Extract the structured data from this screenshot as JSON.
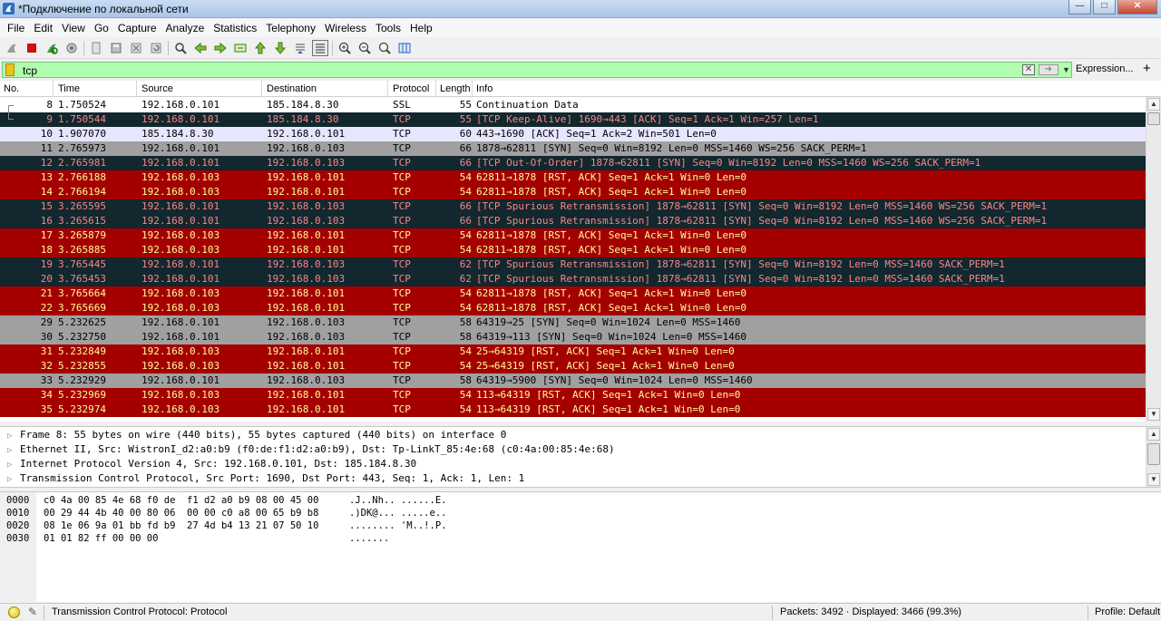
{
  "window": {
    "title": "*Подключение по локальной сети"
  },
  "menu": [
    "File",
    "Edit",
    "View",
    "Go",
    "Capture",
    "Analyze",
    "Statistics",
    "Telephony",
    "Wireless",
    "Tools",
    "Help"
  ],
  "filter": {
    "value": "tcp",
    "expression_label": "Expression...",
    "add_label": "+"
  },
  "columns": {
    "no": "No.",
    "time": "Time",
    "source": "Source",
    "destination": "Destination",
    "protocol": "Protocol",
    "length": "Length",
    "info": "Info"
  },
  "colors": {
    "red_bg": "#a40000",
    "red_fg": "#fffc9c",
    "dark_bg": "#12272e",
    "dark_fg": "#f78787",
    "gray_bg": "#a0a0a0",
    "selected_bg": "#e7e6ff",
    "white_bg": "#ffffff"
  },
  "packets": [
    {
      "no": "8",
      "time": "1.750524",
      "src": "192.168.0.101",
      "dst": "185.184.8.30",
      "proto": "SSL",
      "len": "55",
      "info": "Continuation Data",
      "style": "white"
    },
    {
      "no": "9",
      "time": "1.750544",
      "src": "192.168.0.101",
      "dst": "185.184.8.30",
      "proto": "TCP",
      "len": "55",
      "info": "[TCP Keep-Alive] 1690→443 [ACK] Seq=1 Ack=1 Win=257 Len=1",
      "style": "dark"
    },
    {
      "no": "10",
      "time": "1.907070",
      "src": "185.184.8.30",
      "dst": "192.168.0.101",
      "proto": "TCP",
      "len": "60",
      "info": "443→1690 [ACK] Seq=1 Ack=2 Win=501 Len=0",
      "style": "selected"
    },
    {
      "no": "11",
      "time": "2.765973",
      "src": "192.168.0.101",
      "dst": "192.168.0.103",
      "proto": "TCP",
      "len": "66",
      "info": "1878→62811 [SYN] Seq=0 Win=8192 Len=0 MSS=1460 WS=256 SACK_PERM=1",
      "style": "gray"
    },
    {
      "no": "12",
      "time": "2.765981",
      "src": "192.168.0.101",
      "dst": "192.168.0.103",
      "proto": "TCP",
      "len": "66",
      "info": "[TCP Out-Of-Order] 1878→62811 [SYN] Seq=0 Win=8192 Len=0 MSS=1460 WS=256 SACK_PERM=1",
      "style": "dark"
    },
    {
      "no": "13",
      "time": "2.766188",
      "src": "192.168.0.103",
      "dst": "192.168.0.101",
      "proto": "TCP",
      "len": "54",
      "info": "62811→1878 [RST, ACK] Seq=1 Ack=1 Win=0 Len=0",
      "style": "red"
    },
    {
      "no": "14",
      "time": "2.766194",
      "src": "192.168.0.103",
      "dst": "192.168.0.101",
      "proto": "TCP",
      "len": "54",
      "info": "62811→1878 [RST, ACK] Seq=1 Ack=1 Win=0 Len=0",
      "style": "red"
    },
    {
      "no": "15",
      "time": "3.265595",
      "src": "192.168.0.101",
      "dst": "192.168.0.103",
      "proto": "TCP",
      "len": "66",
      "info": "[TCP Spurious Retransmission] 1878→62811 [SYN] Seq=0 Win=8192 Len=0 MSS=1460 WS=256 SACK_PERM=1",
      "style": "dark"
    },
    {
      "no": "16",
      "time": "3.265615",
      "src": "192.168.0.101",
      "dst": "192.168.0.103",
      "proto": "TCP",
      "len": "66",
      "info": "[TCP Spurious Retransmission] 1878→62811 [SYN] Seq=0 Win=8192 Len=0 MSS=1460 WS=256 SACK_PERM=1",
      "style": "dark"
    },
    {
      "no": "17",
      "time": "3.265879",
      "src": "192.168.0.103",
      "dst": "192.168.0.101",
      "proto": "TCP",
      "len": "54",
      "info": "62811→1878 [RST, ACK] Seq=1 Ack=1 Win=0 Len=0",
      "style": "red"
    },
    {
      "no": "18",
      "time": "3.265885",
      "src": "192.168.0.103",
      "dst": "192.168.0.101",
      "proto": "TCP",
      "len": "54",
      "info": "62811→1878 [RST, ACK] Seq=1 Ack=1 Win=0 Len=0",
      "style": "red"
    },
    {
      "no": "19",
      "time": "3.765445",
      "src": "192.168.0.101",
      "dst": "192.168.0.103",
      "proto": "TCP",
      "len": "62",
      "info": "[TCP Spurious Retransmission] 1878→62811 [SYN] Seq=0 Win=8192 Len=0 MSS=1460 SACK_PERM=1",
      "style": "dark"
    },
    {
      "no": "20",
      "time": "3.765453",
      "src": "192.168.0.101",
      "dst": "192.168.0.103",
      "proto": "TCP",
      "len": "62",
      "info": "[TCP Spurious Retransmission] 1878→62811 [SYN] Seq=0 Win=8192 Len=0 MSS=1460 SACK_PERM=1",
      "style": "dark"
    },
    {
      "no": "21",
      "time": "3.765664",
      "src": "192.168.0.103",
      "dst": "192.168.0.101",
      "proto": "TCP",
      "len": "54",
      "info": "62811→1878 [RST, ACK] Seq=1 Ack=1 Win=0 Len=0",
      "style": "red"
    },
    {
      "no": "22",
      "time": "3.765669",
      "src": "192.168.0.103",
      "dst": "192.168.0.101",
      "proto": "TCP",
      "len": "54",
      "info": "62811→1878 [RST, ACK] Seq=1 Ack=1 Win=0 Len=0",
      "style": "red"
    },
    {
      "no": "29",
      "time": "5.232625",
      "src": "192.168.0.101",
      "dst": "192.168.0.103",
      "proto": "TCP",
      "len": "58",
      "info": "64319→25 [SYN] Seq=0 Win=1024 Len=0 MSS=1460",
      "style": "gray"
    },
    {
      "no": "30",
      "time": "5.232750",
      "src": "192.168.0.101",
      "dst": "192.168.0.103",
      "proto": "TCP",
      "len": "58",
      "info": "64319→113 [SYN] Seq=0 Win=1024 Len=0 MSS=1460",
      "style": "gray"
    },
    {
      "no": "31",
      "time": "5.232849",
      "src": "192.168.0.103",
      "dst": "192.168.0.101",
      "proto": "TCP",
      "len": "54",
      "info": "25→64319 [RST, ACK] Seq=1 Ack=1 Win=0 Len=0",
      "style": "red"
    },
    {
      "no": "32",
      "time": "5.232855",
      "src": "192.168.0.103",
      "dst": "192.168.0.101",
      "proto": "TCP",
      "len": "54",
      "info": "25→64319 [RST, ACK] Seq=1 Ack=1 Win=0 Len=0",
      "style": "red"
    },
    {
      "no": "33",
      "time": "5.232929",
      "src": "192.168.0.101",
      "dst": "192.168.0.103",
      "proto": "TCP",
      "len": "58",
      "info": "64319→5900 [SYN] Seq=0 Win=1024 Len=0 MSS=1460",
      "style": "gray"
    },
    {
      "no": "34",
      "time": "5.232969",
      "src": "192.168.0.103",
      "dst": "192.168.0.101",
      "proto": "TCP",
      "len": "54",
      "info": "113→64319 [RST, ACK] Seq=1 Ack=1 Win=0 Len=0",
      "style": "red"
    },
    {
      "no": "35",
      "time": "5.232974",
      "src": "192.168.0.103",
      "dst": "192.168.0.101",
      "proto": "TCP",
      "len": "54",
      "info": "113→64319 [RST, ACK] Seq=1 Ack=1 Win=0 Len=0",
      "style": "red"
    }
  ],
  "details": [
    "Frame 8: 55 bytes on wire (440 bits), 55 bytes captured (440 bits) on interface 0",
    "Ethernet II, Src: WistronI_d2:a0:b9 (f0:de:f1:d2:a0:b9), Dst: Tp-LinkT_85:4e:68 (c0:4a:00:85:4e:68)",
    "Internet Protocol Version 4, Src: 192.168.0.101, Dst: 185.184.8.30",
    "Transmission Control Protocol, Src Port: 1690, Dst Port: 443, Seq: 1, Ack: 1, Len: 1"
  ],
  "bytes": [
    {
      "offset": "0000",
      "hex": "c0 4a 00 85 4e 68 f0 de  f1 d2 a0 b9 08 00 45 00",
      "ascii": ".J..Nh.. ......E."
    },
    {
      "offset": "0010",
      "hex": "00 29 44 4b 40 00 80 06  00 00 c0 a8 00 65 b9 b8",
      "ascii": ".)DK@... .....e.."
    },
    {
      "offset": "0020",
      "hex": "08 1e 06 9a 01 bb fd b9  27 4d b4 13 21 07 50 10",
      "ascii": "........ 'M..!.P."
    },
    {
      "offset": "0030",
      "hex": "01 01 82 ff 00 00 00",
      "ascii": "......."
    }
  ],
  "status": {
    "field_info": "Transmission Control Protocol: Protocol",
    "packets": "Packets: 3492 · Displayed: 3466 (99.3%)",
    "profile": "Profile: Default"
  }
}
